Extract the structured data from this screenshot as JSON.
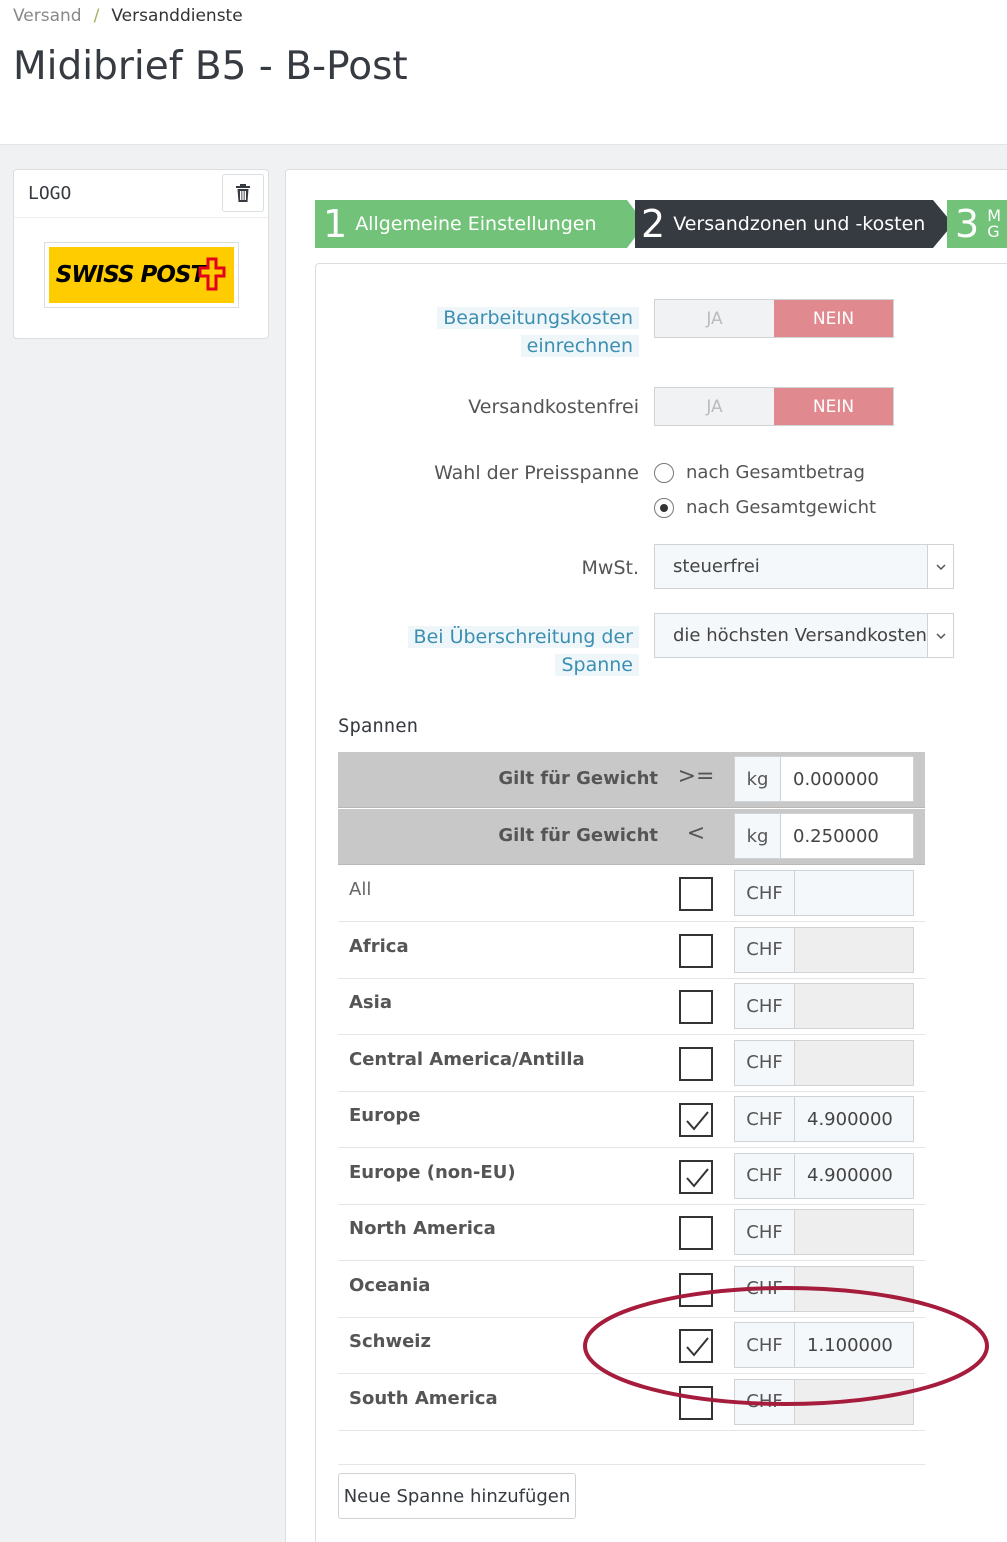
{
  "breadcrumb": {
    "parent": "Versand",
    "separator": "/",
    "current": "Versanddienste"
  },
  "page_title": "Midibrief B5 - B-Post",
  "logo_panel": {
    "title": "LOGO",
    "logo_text": "SWISS POST",
    "brand_color": "#ffcc00",
    "cross_color": "#e2001a"
  },
  "steps": [
    {
      "num": "1",
      "label": "Allgemeine Einstellungen",
      "state": "done"
    },
    {
      "num": "2",
      "label": "Versandzonen und -kosten",
      "state": "active"
    },
    {
      "num": "3",
      "label": "M",
      "label2": "G",
      "state": "next"
    }
  ],
  "form": {
    "bearbeitung": {
      "label_line1": "Bearbeitungskosten",
      "label_line2": "einrechnen",
      "yes": "JA",
      "no": "NEIN",
      "selected": "NEIN"
    },
    "versandkostenfrei": {
      "label": "Versandkostenfrei",
      "yes": "JA",
      "no": "NEIN",
      "selected": "NEIN"
    },
    "preisspanne": {
      "label": "Wahl der Preisspanne",
      "option1": "nach Gesamtbetrag",
      "option2": "nach Gesamtgewicht",
      "selected": "nach Gesamtgewicht"
    },
    "mwst": {
      "label": "MwSt.",
      "value": "steuerfrei"
    },
    "ueberschreitung": {
      "label_line1": "Bei Überschreitung der",
      "label_line2": "Spanne",
      "value": "die höchsten Versandkosten a"
    }
  },
  "spannen": {
    "title": "Spannen",
    "ranges": [
      {
        "label": "Gilt für Gewicht",
        "operator": ">=",
        "unit": "kg",
        "value": "0.000000"
      },
      {
        "label": "Gilt für Gewicht",
        "operator": "<",
        "unit": "kg",
        "value": "0.250000"
      }
    ],
    "currency": "CHF",
    "zones": [
      {
        "name": "All",
        "checked": false,
        "value": ""
      },
      {
        "name": "Africa",
        "checked": false,
        "value": ""
      },
      {
        "name": "Asia",
        "checked": false,
        "value": ""
      },
      {
        "name": "Central America/Antilla",
        "checked": false,
        "value": ""
      },
      {
        "name": "Europe",
        "checked": true,
        "value": "4.900000"
      },
      {
        "name": "Europe (non-EU)",
        "checked": true,
        "value": "4.900000"
      },
      {
        "name": "North America",
        "checked": false,
        "value": ""
      },
      {
        "name": "Oceania",
        "checked": false,
        "value": ""
      },
      {
        "name": "Schweiz",
        "checked": true,
        "value": "1.100000"
      },
      {
        "name": "South America",
        "checked": false,
        "value": ""
      }
    ],
    "add_button": "Neue Spanne hinzufügen"
  },
  "colors": {
    "accent_green": "#72c279",
    "dark_step": "#363a41",
    "nein_red": "#e08a90",
    "highlight_ellipse": "#a51c3c"
  }
}
